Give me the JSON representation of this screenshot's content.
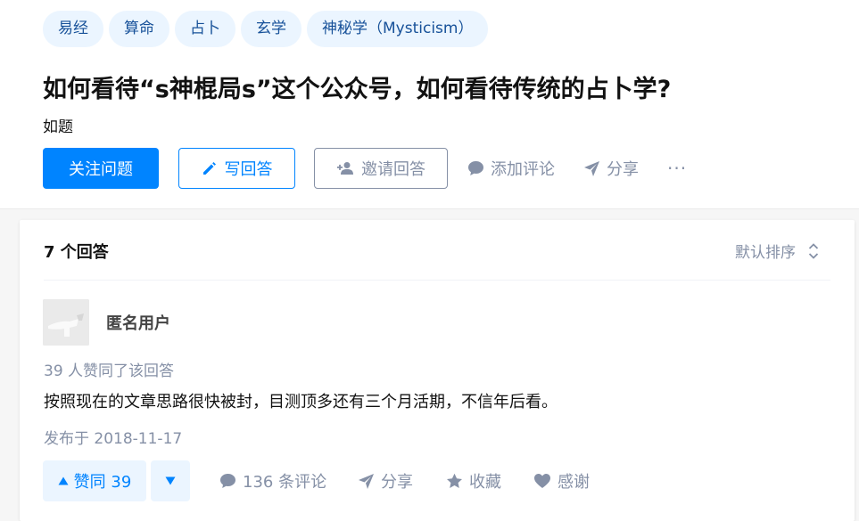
{
  "question": {
    "topics": [
      "易经",
      "算命",
      "占卜",
      "玄学",
      "神秘学（Mysticism）"
    ],
    "title": "如何看待“s神棍局s”这个公众号，如何看待传统的占卜学?",
    "detail": "如题",
    "actions": {
      "follow": "关注问题",
      "write": "写回答",
      "invite": "邀请回答",
      "comment": "添加评论",
      "share": "分享",
      "more": "···"
    }
  },
  "answers": {
    "count_label": "7 个回答",
    "sort_label": "默认排序",
    "items": [
      {
        "author": "匿名用户",
        "voters": "39 人赞同了该回答",
        "content": "按照现在的文章思路很快被封，目测顶多还有三个月活期，不信年后看。",
        "published": "发布于 2018-11-17",
        "vote_label": "赞同 39",
        "comments_label": "136 条评论",
        "share_label": "分享",
        "collect_label": "收藏",
        "thanks_label": "感谢"
      }
    ]
  },
  "colors": {
    "primary": "#0084ff",
    "tag_bg": "#ebf5ff",
    "tag_text": "#175199",
    "muted": "#8590a6"
  },
  "icons": [
    "pencil-icon",
    "add-user-icon",
    "comment-bubble-icon",
    "paper-plane-icon",
    "more-icon",
    "sort-icon",
    "triangle-up-icon",
    "triangle-down-icon",
    "star-icon",
    "heart-icon"
  ]
}
